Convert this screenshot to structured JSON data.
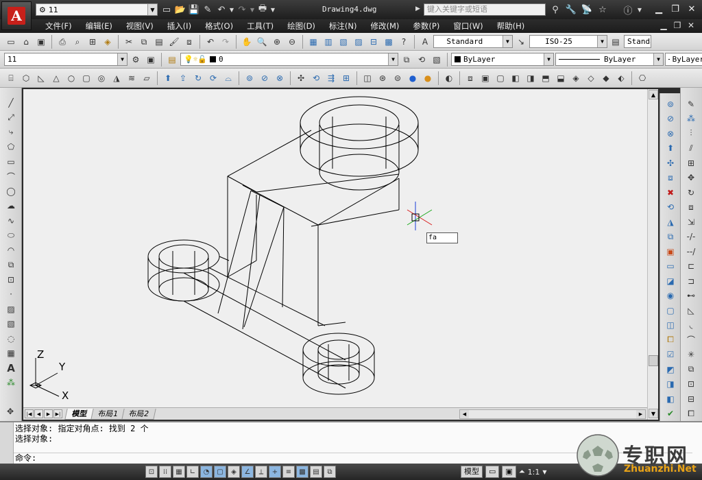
{
  "titlebar": {
    "workspace": "11",
    "document": "Drawing4.dwg",
    "search_placeholder": "键入关键字或短语",
    "app_letter": "A"
  },
  "menu": {
    "items": [
      "文件(F)",
      "编辑(E)",
      "视图(V)",
      "插入(I)",
      "格式(O)",
      "工具(T)",
      "绘图(D)",
      "标注(N)",
      "修改(M)",
      "参数(P)",
      "窗口(W)",
      "帮助(H)"
    ]
  },
  "styles": {
    "text_style": "Standard",
    "dim_style": "ISO-25",
    "table_style": "Standard"
  },
  "layers": {
    "workspace_combo": "11",
    "layer_name": "0",
    "color": "ByLayer",
    "linetype": "ByLayer",
    "lineweight": "ByLayer"
  },
  "canvas": {
    "command_input": "fa",
    "ucs_labels": {
      "z": "Z",
      "y": "Y",
      "x": "X"
    }
  },
  "layout_tabs": [
    "模型",
    "布局1",
    "布局2"
  ],
  "command_window": {
    "lines": [
      "选择对象: 指定对角点: 找到 2 个",
      "选择对象:"
    ],
    "prompt": "命令:"
  },
  "statusbar": {
    "model_label": "模型",
    "scale": "1:1"
  },
  "watermark": {
    "text": "专职网",
    "url": "Zhuanzhi.Net"
  }
}
